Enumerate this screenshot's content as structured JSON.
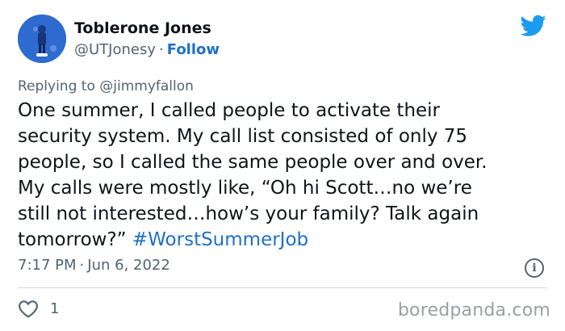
{
  "author": {
    "name": "Toblerone Jones",
    "handle": "@UTJonesy",
    "separator": "·",
    "follow_label": "Follow"
  },
  "reply": {
    "prefix": "Replying to",
    "mention": "@jimmyfallon"
  },
  "tweet": {
    "lines": [
      "One summer, I called people to activate their",
      "security system.  My call list consisted of only 75",
      "people, so I called the same people over and over.",
      "My calls were mostly like, “Oh hi Scott…no we’re",
      "still not interested…how’s your family? Talk again"
    ],
    "last_line_text": "tomorrow?”",
    "hashtag": "#WorstSummerJob"
  },
  "meta": {
    "time": "7:17 PM",
    "separator": "·",
    "date": "Jun 6, 2022",
    "info_glyph": "i"
  },
  "engagement": {
    "like_count": "1"
  },
  "watermark": "boredpanda.com",
  "colors": {
    "accent": "#1d70c9",
    "twitter_blue": "#1d9bf0",
    "muted": "#536471",
    "text": "#0f1419"
  },
  "icons": {
    "brand": "twitter-bird-icon",
    "like": "heart-icon",
    "info": "info-icon"
  }
}
